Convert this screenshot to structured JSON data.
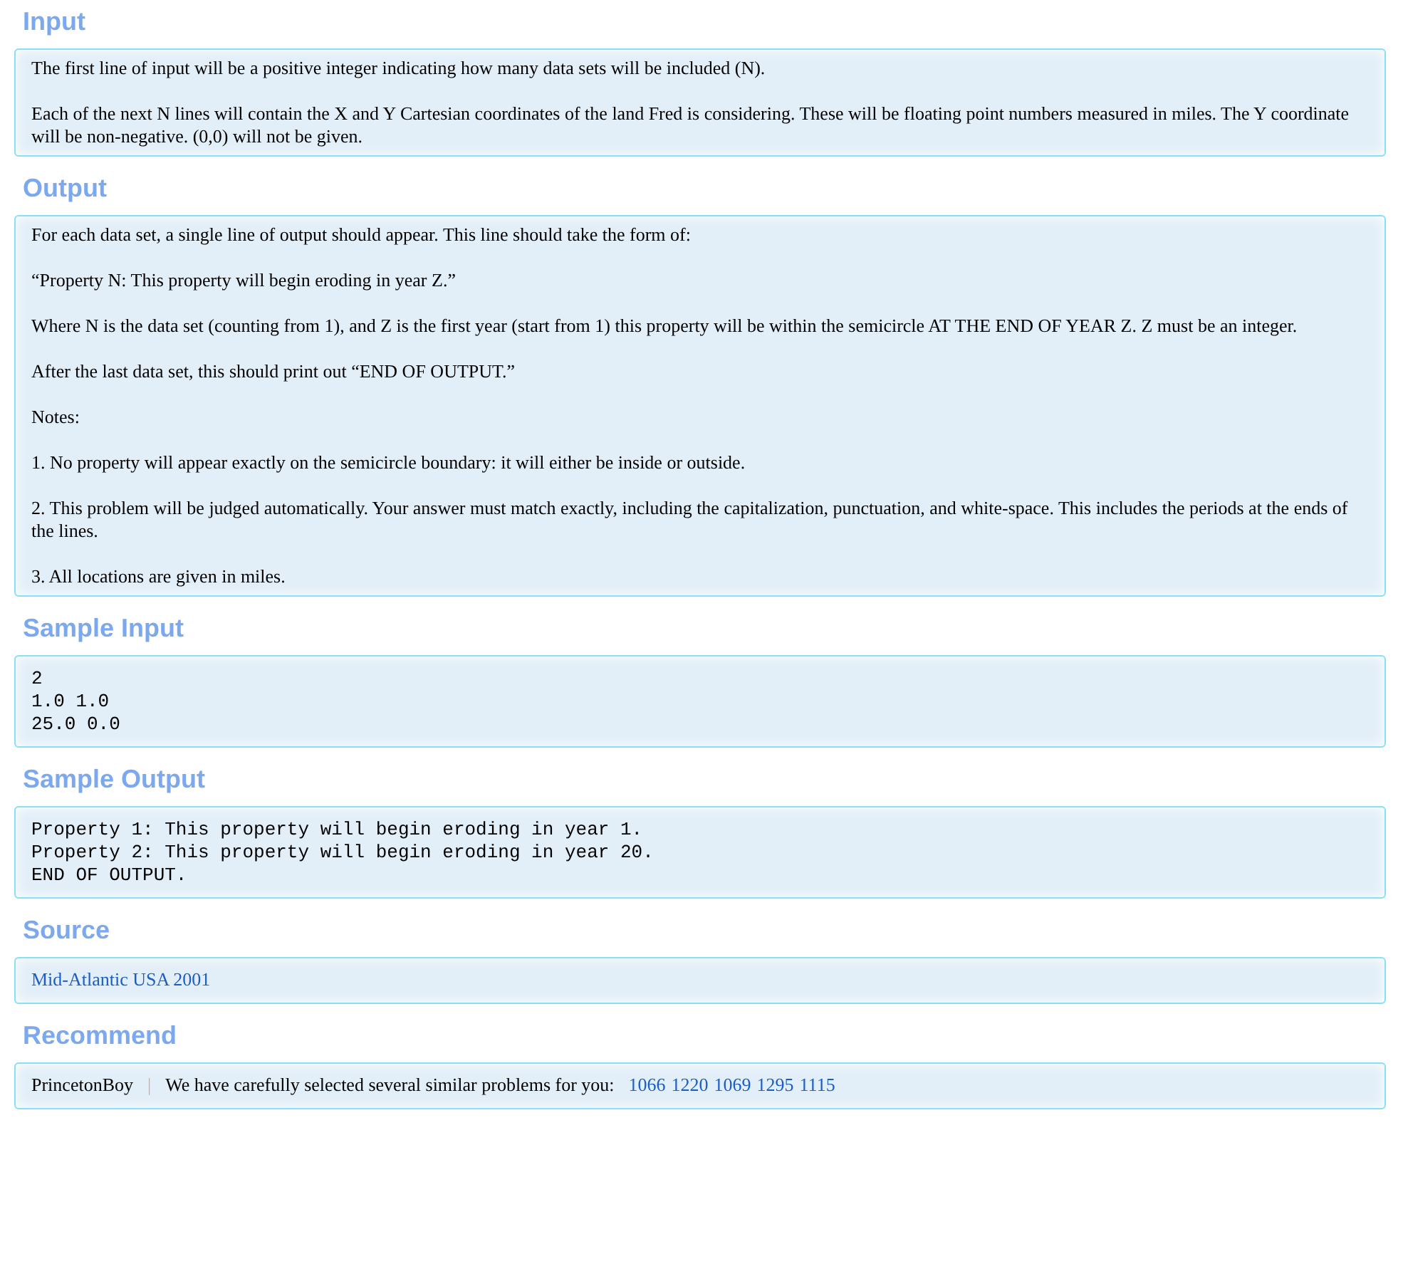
{
  "sections": [
    {
      "title": "Input",
      "kind": "text",
      "paragraphs": [
        "The first line of input will be a positive integer indicating how many data sets will be included (N).",
        "Each of the next N lines will contain the X and Y Cartesian coordinates of the land Fred is considering. These will be floating point numbers measured in miles. The Y coordinate will be non-negative. (0,0) will not be given."
      ]
    },
    {
      "title": "Output",
      "kind": "text",
      "paragraphs": [
        "For each data set, a single line of output should appear. This line should take the form of:",
        "“Property N: This property will begin eroding in year Z.”",
        "Where N is the data set (counting from 1), and Z is the first year (start from 1) this property will be within the semicircle AT THE END OF YEAR Z. Z must be an integer.",
        "After the last data set, this should print out “END OF OUTPUT.”",
        "Notes:",
        "1. No property will appear exactly on the semicircle boundary: it will either be inside or outside.",
        "2. This problem will be judged automatically. Your answer must match exactly, including the capitalization, punctuation, and white-space. This includes the periods at the ends of the lines.",
        "3. All locations are given in miles."
      ]
    },
    {
      "title": "Sample Input",
      "kind": "code",
      "lines": [
        "2",
        "1.0 1.0",
        "25.0 0.0"
      ]
    },
    {
      "title": "Sample Output",
      "kind": "code",
      "lines": [
        "Property 1: This property will begin eroding in year 1.",
        "Property 2: This property will begin eroding in year 20.",
        "END OF OUTPUT."
      ]
    },
    {
      "title": "Source",
      "kind": "source",
      "link": "Mid-Atlantic USA 2001"
    },
    {
      "title": "Recommend",
      "kind": "recommend",
      "author": "PrincetonBoy",
      "separator": "|",
      "lead": "We have carefully selected several similar problems for you:",
      "problems": [
        "1066",
        "1220",
        "1069",
        "1295",
        "1115"
      ]
    }
  ]
}
